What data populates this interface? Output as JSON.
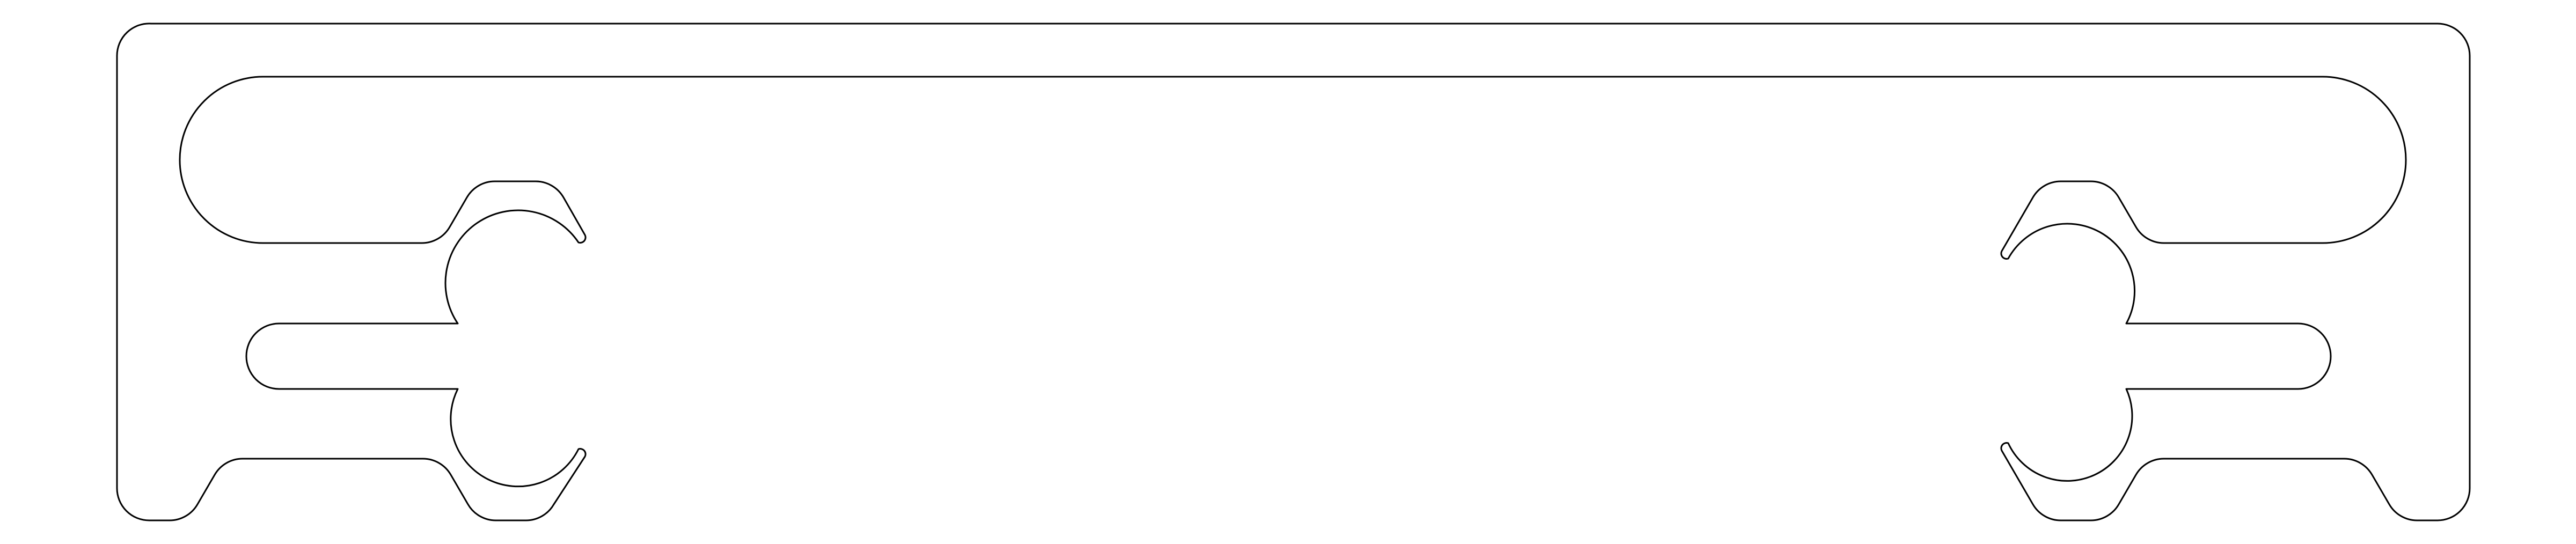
{
  "drawing": {
    "kind": "cad-line-drawing",
    "description_visible_text": [],
    "colors": {
      "background": "#ffffff",
      "line": "#000000"
    },
    "parts": [
      {
        "name": "outer-profile"
      },
      {
        "name": "upper-slot"
      },
      {
        "name": "lower-slot"
      }
    ]
  }
}
